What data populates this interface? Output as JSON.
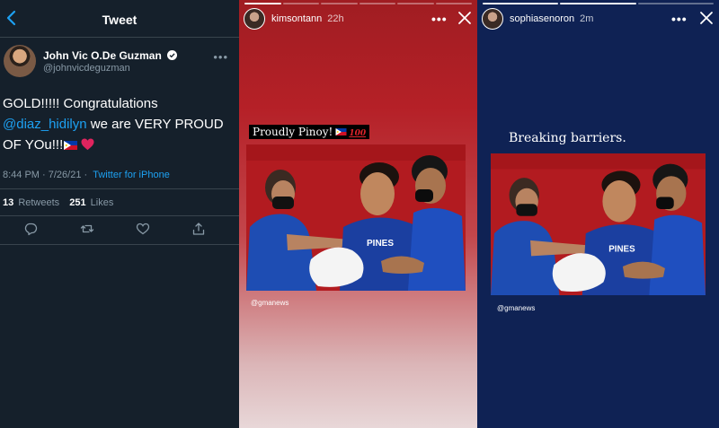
{
  "tweet": {
    "header_title": "Tweet",
    "author_name": "John Vic O.De Guzman",
    "author_handle": "@johnvicdeguzman",
    "text_line1": "GOLD!!!!! Congratulations",
    "mention": "@diaz_hidilyn",
    "text_line2": " we are VERY PROUD",
    "text_line3": "OF YOu!!!",
    "timestamp": "8:44 PM · 7/26/21 · ",
    "source": "Twitter for iPhone",
    "retweets_count": "13",
    "retweets_label": "Retweets",
    "likes_count": "251",
    "likes_label": "Likes",
    "icons": [
      "back-chevron-icon",
      "verified-badge-icon",
      "more-icon",
      "reply-icon",
      "retweet-icon",
      "like-icon",
      "share-icon"
    ],
    "accent": "#1da1f2"
  },
  "story_kim": {
    "username": "kimsontann",
    "time": "22h",
    "caption": "Proudly Pinoy!",
    "caption_badge": "100",
    "credit": "@gmanews",
    "progress_segments": 6,
    "progress_active": 1
  },
  "story_sophia": {
    "username": "sophiasenoron",
    "time": "2m",
    "caption": "Breaking barriers.",
    "credit": "@gmanews",
    "progress_segments": 3,
    "progress_active": 2
  },
  "photo": {
    "jersey_text": "PINES"
  },
  "colors": {
    "twitter_bg": "#15202b",
    "story_red": "#b52027",
    "story_navy": "#0f2254"
  }
}
